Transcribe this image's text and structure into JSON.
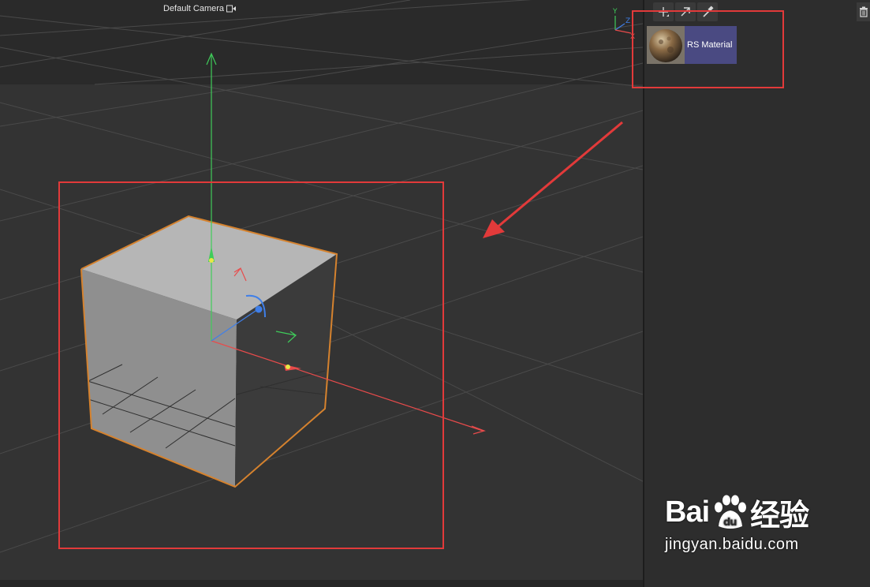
{
  "viewport": {
    "camera_label": "Default Camera",
    "camera_icon": "camera-icon",
    "axis_labels": {
      "x": "X",
      "y": "Y",
      "z": "Z"
    }
  },
  "material_manager": {
    "toolbar": [
      {
        "name": "add-material",
        "icon": "plus-icon"
      },
      {
        "name": "apply-material",
        "icon": "arrow-up-right-icon"
      },
      {
        "name": "pick-material",
        "icon": "eyedropper-icon"
      }
    ],
    "trash_icon": "trash-icon",
    "materials": [
      {
        "name": "RS Material",
        "icon": "material-sphere-icon",
        "selected": true
      }
    ]
  },
  "colors": {
    "highlight": "#e23a3a",
    "selection_outline": "#d5822e",
    "material_selected_bg": "#4a4a82",
    "axis_x": "#e84b4b",
    "axis_y": "#3fcc5a",
    "axis_z": "#3f7fe8"
  },
  "watermark": {
    "brand_left": "Bai",
    "brand_right": "du",
    "brand_suffix": "经验",
    "url": "jingyan.baidu.com"
  }
}
